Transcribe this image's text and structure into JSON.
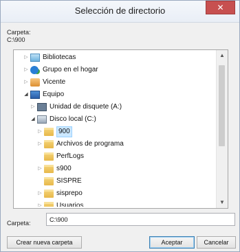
{
  "window": {
    "title": "Selección de directorio",
    "close_glyph": "✕"
  },
  "path_label": "Carpeta:",
  "path_value": "C:\\900",
  "tree": {
    "rows": [
      {
        "label": "Bibliotecas",
        "icon": "library-icon",
        "expander": "▷",
        "selected": false
      },
      {
        "label": "Grupo en el hogar",
        "icon": "homegroup-icon",
        "expander": "▷",
        "selected": false
      },
      {
        "label": "Vicente",
        "icon": "user-folder-icon",
        "expander": "▷",
        "selected": false
      },
      {
        "label": "Equipo",
        "icon": "computer-icon",
        "expander": "◢",
        "selected": false
      },
      {
        "label": "Unidad de disquete (A:)",
        "icon": "floppy-drive-icon",
        "expander": "▷",
        "selected": false
      },
      {
        "label": "Disco local (C:)",
        "icon": "local-disk-icon",
        "expander": "◢",
        "selected": false
      },
      {
        "label": "900",
        "icon": "folder-icon",
        "expander": "▷",
        "selected": true
      },
      {
        "label": "Archivos de programa",
        "icon": "folder-icon",
        "expander": "▷",
        "selected": false
      },
      {
        "label": "PerfLogs",
        "icon": "folder-icon",
        "expander": "",
        "selected": false
      },
      {
        "label": "s900",
        "icon": "folder-icon",
        "expander": "▷",
        "selected": false
      },
      {
        "label": "SISPRE",
        "icon": "folder-icon",
        "expander": "",
        "selected": false
      },
      {
        "label": "sisprepo",
        "icon": "folder-icon",
        "expander": "▷",
        "selected": false
      },
      {
        "label": "Usuarios",
        "icon": "folder-icon",
        "expander": "▷",
        "selected": false
      }
    ],
    "scroll_up_glyph": "▲",
    "scroll_down_glyph": "▼"
  },
  "folder_field": {
    "label": "Carpeta:",
    "value": "C:\\900"
  },
  "buttons": {
    "new_folder": "Crear nueva carpeta",
    "accept": "Aceptar",
    "cancel": "Cancelar"
  },
  "colors": {
    "selection": "#cce8ff",
    "close_button": "#c75050"
  }
}
